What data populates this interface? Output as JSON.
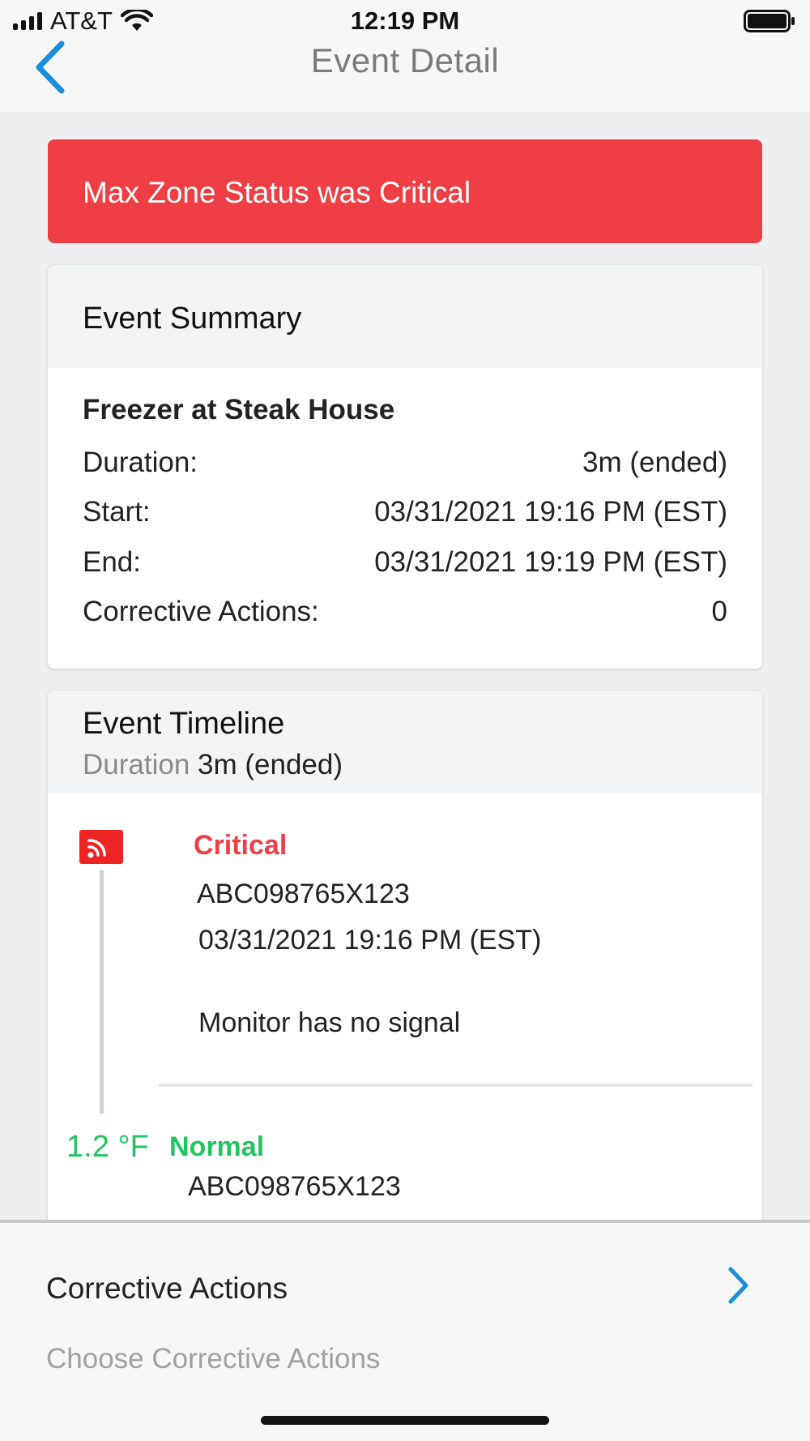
{
  "status_bar": {
    "carrier": "AT&T",
    "time": "12:19 PM"
  },
  "nav": {
    "title": "Event Detail"
  },
  "alert": {
    "text": "Max Zone Status was Critical",
    "color": "#ef3f45"
  },
  "summary": {
    "title": "Event Summary",
    "location": "Freezer at Steak House",
    "rows": [
      {
        "label": "Duration:",
        "value": "3m (ended)"
      },
      {
        "label": "Start:",
        "value": "03/31/2021 19:16 PM (EST)"
      },
      {
        "label": "End:",
        "value": "03/31/2021 19:19 PM (EST)"
      },
      {
        "label": "Corrective Actions:",
        "value": "0"
      }
    ]
  },
  "timeline": {
    "title": "Event Timeline",
    "duration_label": "Duration",
    "duration_value": "3m (ended)",
    "events": [
      {
        "status": "Critical",
        "status_color": "#ee3f45",
        "icon": "no-signal-icon",
        "device": "ABC098765X123",
        "time": "03/31/2021 19:16 PM (EST)",
        "message": "Monitor has no signal"
      },
      {
        "status": "Normal",
        "status_color": "#22c55e",
        "temperature": "1.2 °F",
        "device": "ABC098765X123"
      }
    ]
  },
  "corrective_actions": {
    "title": "Corrective Actions",
    "subtitle": "Choose Corrective Actions"
  },
  "colors": {
    "accent": "#1a8fd8",
    "critical": "#ef3f45",
    "normal": "#22c55e"
  }
}
